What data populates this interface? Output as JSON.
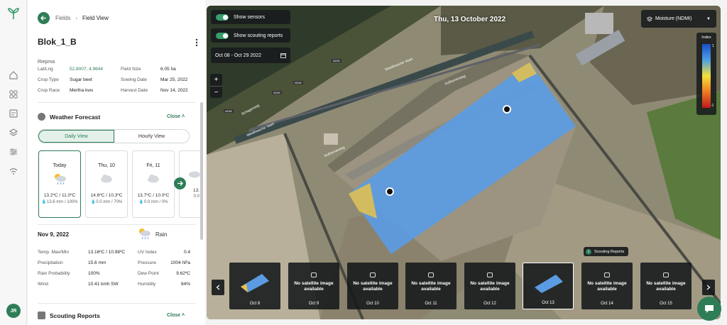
{
  "breadcrumb": {
    "parent": "Fields",
    "current": "Field View"
  },
  "field": {
    "name": "Blok_1_B",
    "owner": "Riepma",
    "latlng_label": "Lat/Lng",
    "latlng_value": "52.8007, 4.9644",
    "field_size_label": "Field Size",
    "field_size_value": "6.05 ha",
    "crop_type_label": "Crop Type",
    "crop_type_value": "Sugar beet",
    "sowing_date_label": "Sowing Date",
    "sowing_date_value": "Mar 25, 2022",
    "crop_race_label": "Crop Race",
    "crop_race_value": "Mertha kws",
    "harvest_date_label": "Harvest Date",
    "harvest_date_value": "Nov 14, 2022"
  },
  "weather": {
    "title": "Weather Forecast",
    "close_label": "Close",
    "daily_view": "Daily View",
    "hourly_view": "Hourly View",
    "cards": [
      {
        "day": "Today",
        "temp": "13.2ºC / 11.0ºC",
        "rain": "13.6 mm / 100%",
        "icon": "sun-rain-icon"
      },
      {
        "day": "Thu, 10",
        "temp": "14.6ºC / 10.3ºC",
        "rain": "0.0 mm / 70%",
        "icon": "cloud-icon"
      },
      {
        "day": "Fri, 11",
        "temp": "13.7ºC / 10.0ºC",
        "rain": "0.0 mm / 0%",
        "icon": "cloud-icon"
      },
      {
        "day": "",
        "temp": "13.",
        "rain": "0.0",
        "icon": "cloud-icon"
      }
    ],
    "detail": {
      "date": "Nov 9, 2022",
      "condition": "Rain",
      "temp_label": "Temp. Max/Min",
      "temp_value": "13.16ºC / 10.98ºC",
      "precip_label": "Precipitation",
      "precip_value": "15.6 mm",
      "rain_prob_label": "Rain Probability",
      "rain_prob_value": "100%",
      "wind_label": "Wind",
      "wind_value": "10.41 kmh SW",
      "uv_label": "UV Index",
      "uv_value": "0.4",
      "pressure_label": "Pressure",
      "pressure_value": "1004 hPa",
      "dew_label": "Dew Point",
      "dew_value": "9.62ºC",
      "humidity_label": "Humidity",
      "humidity_value": "84%"
    }
  },
  "scouting": {
    "title": "Scouting Reports",
    "close_label": "Close"
  },
  "user": {
    "initials": "JR"
  },
  "map": {
    "show_sensors": "Show sensors",
    "show_scouting": "Show scouting reports",
    "date_range": "Oct 08 - Oct 29 2022",
    "date": "Thu, 13 October 2022",
    "layer": "Moisture (NDMI)",
    "legend_title": "Index",
    "legend_max": "1",
    "legend_min": "-1",
    "scouting_badge_count": "1",
    "scouting_badge_label": "Scouting Reports",
    "roads": [
      "Westfriesche Vaart",
      "Westfriesche Vaart",
      "Kolhornerweg",
      "Kolhornerweg",
      "Schagerweg",
      "N248",
      "N248",
      "N248",
      "N248"
    ],
    "thumbnails": [
      {
        "date": "Oct 8",
        "available": true,
        "text": ""
      },
      {
        "date": "Oct 9",
        "available": false,
        "text": "No satellite image available"
      },
      {
        "date": "Oct 10",
        "available": false,
        "text": "No satellite image available"
      },
      {
        "date": "Oct 11",
        "available": false,
        "text": "No satellite image available"
      },
      {
        "date": "Oct 12",
        "available": false,
        "text": "No satellite image available"
      },
      {
        "date": "Oct 13",
        "available": true,
        "text": ""
      },
      {
        "date": "Oct 14",
        "available": false,
        "text": "No satellite image available"
      },
      {
        "date": "Oct 15",
        "available": false,
        "text": "No satellite image available"
      }
    ]
  },
  "colors": {
    "accent": "#2e7d57",
    "ndmi_high": "#1a4fc7",
    "ndmi_mid": "#4e9ee6",
    "ndmi_low": "#c21a1a"
  }
}
